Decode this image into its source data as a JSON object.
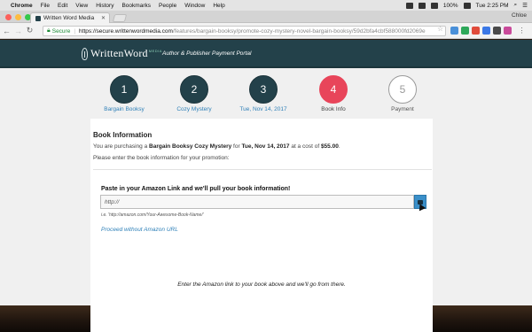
{
  "menubar": {
    "apple_icon": "apple-icon",
    "app": "Chrome",
    "items": [
      "File",
      "Edit",
      "View",
      "History",
      "Bookmarks",
      "People",
      "Window",
      "Help"
    ],
    "battery": "100%",
    "clock": "Tue 2:25 PM"
  },
  "browser": {
    "tab_title": "Written Word Media",
    "profile": "Chloe",
    "secure_label": "Secure",
    "url_host": "https://secure.writtenwordmedia.com",
    "url_path": "/features/bargain-booksy/promote-cozy-mystery-novel-bargain-booksy/59d2bfa4cbf588000fd2069e"
  },
  "header": {
    "logo_name": "WrittenWord",
    "logo_suffix": "MEDIA",
    "portal_title": "Author & Publisher Payment Portal"
  },
  "steps": [
    {
      "number": "1",
      "label": "Bargain Booksy",
      "state": "done"
    },
    {
      "number": "2",
      "label": "Cozy Mystery",
      "state": "done"
    },
    {
      "number": "3",
      "label": "Tue, Nov 14, 2017",
      "state": "done"
    },
    {
      "number": "4",
      "label": "Book Info",
      "state": "current"
    },
    {
      "number": "5",
      "label": "Payment",
      "state": "todo"
    }
  ],
  "colors": {
    "header_bg": "#23414a",
    "step_done": "#23414a",
    "step_current": "#e8455a",
    "step_link": "#2f80b8",
    "go_button": "#3a8fc9"
  },
  "book_info": {
    "title": "Book Information",
    "purchase_prefix": "You are purchasing a",
    "product": "Bargain Booksy Cozy Mystery",
    "purchase_mid": "for",
    "date": "Tue, Nov 14, 2017",
    "cost_prefix": "at a cost of",
    "cost": "$55.00",
    "instructions": "Please enter the book information for your promotion:"
  },
  "amazon": {
    "label": "Paste in your Amazon Link and we'll pull your book information!",
    "value": "http://",
    "example": "i.e. 'http://amazon.com/Your-Awesome-Book-Name/'",
    "proceed_link": "Proceed without Amazon URL",
    "bottom_message": "Enter the Amazon link to your book above and we'll go from there."
  }
}
